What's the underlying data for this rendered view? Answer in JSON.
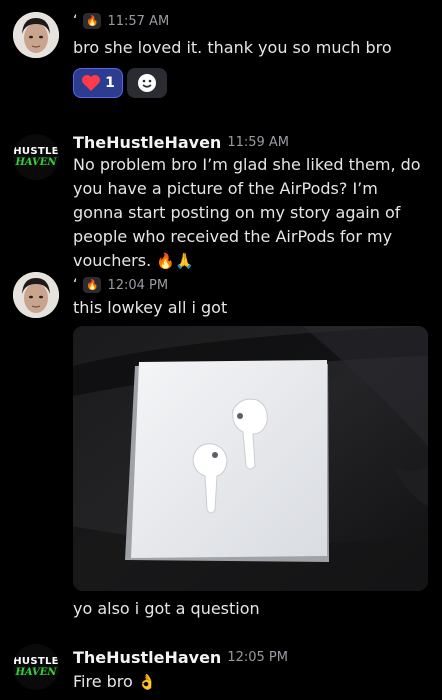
{
  "messages": [
    {
      "time": "11:57 AM",
      "text": "bro she loved it. thank you so much bro",
      "reactions": {
        "heart_count": "1"
      }
    },
    {
      "username": "TheHustleHaven",
      "time": "11:59 AM",
      "text": "No problem bro I’m glad she liked them, do you have a picture of the AirPods? I’m gonna start posting on my story again of people who received the AirPods for my vouchers.",
      "avatar_text": [
        "HUSTLE",
        "HAVEN"
      ]
    },
    {
      "time": "12:04 PM",
      "text": "this lowkey all i got",
      "text2": "yo also i got a question"
    },
    {
      "username": "TheHustleHaven",
      "time": "12:05 PM",
      "text": "Fire bro",
      "avatar_text": [
        "HUSTLE",
        "HAVEN"
      ]
    }
  ],
  "colors": {
    "background": "#000000",
    "reaction_active": "#2c3d8f",
    "reaction_border": "#5865f2",
    "brand_green": "#35d23a"
  },
  "icons": [
    "fire-icon",
    "heart-icon",
    "add-reaction-icon",
    "pray-icon",
    "ok-hand-icon"
  ]
}
